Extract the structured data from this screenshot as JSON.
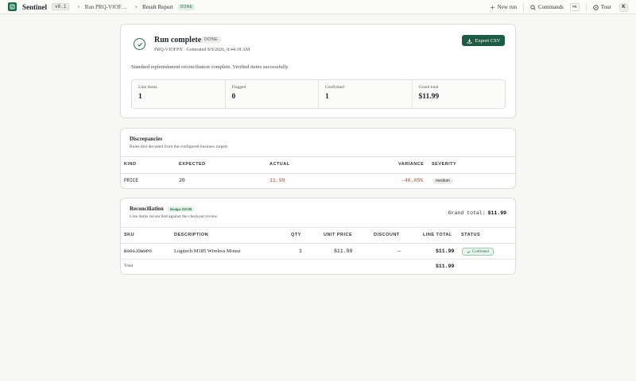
{
  "topbar": {
    "brand": "Sentinel",
    "version": "v0.1",
    "breadcrumb_run": "Run PRQ-VJOF…",
    "breadcrumb_page": "Result Report",
    "status": "DONE",
    "new_run": "New run",
    "commands": "Commands",
    "commands_kbd": "⌘K",
    "tour": "Tour",
    "avatar": "K"
  },
  "run": {
    "title": "Run complete",
    "status": "DONE",
    "meta": "PRQ-VJOFPN · Generated 8/9/2026, 8:44:18 AM",
    "export_label": "Export CSV",
    "summary": "Standard replenishment reconciliation complete. Verified items successfully.",
    "stats": [
      {
        "label": "Line items",
        "value": "1"
      },
      {
        "label": "Flagged",
        "value": "0"
      },
      {
        "label": "Confirmed",
        "value": "1"
      },
      {
        "label": "Grand total",
        "value": "$11.99"
      }
    ]
  },
  "discrepancies": {
    "title": "Discrepancies",
    "subtitle": "Rules that deviated from the configured business targets",
    "columns": [
      "KIND",
      "EXPECTED",
      "ACTUAL",
      "VARIANCE",
      "SEVERITY"
    ],
    "rows": [
      {
        "kind": "PRICE",
        "expected": "20",
        "actual": "11.99",
        "variance": "-40.05%",
        "severity": "medium"
      }
    ]
  },
  "reconciliation": {
    "title": "Reconciliation",
    "budget": "Budget $20.00",
    "subtitle": "Line items reconciled against the checkout review.",
    "grand_total_label": "Grand total:",
    "grand_total_value": "$11.99",
    "columns": [
      "SKU",
      "DESCRIPTION",
      "QTY",
      "UNIT PRICE",
      "DISCOUNT",
      "LINE TOTAL",
      "STATUS"
    ],
    "rows": [
      {
        "sku": "B00GJDWHPO",
        "description": "Logitech M185 Wireless Mouse",
        "qty": "1",
        "unit_price": "$11.99",
        "discount": "—",
        "line_total": "$11.99",
        "status": "Confirmed"
      }
    ],
    "total_label": "Total",
    "total_value": "$11.99"
  }
}
